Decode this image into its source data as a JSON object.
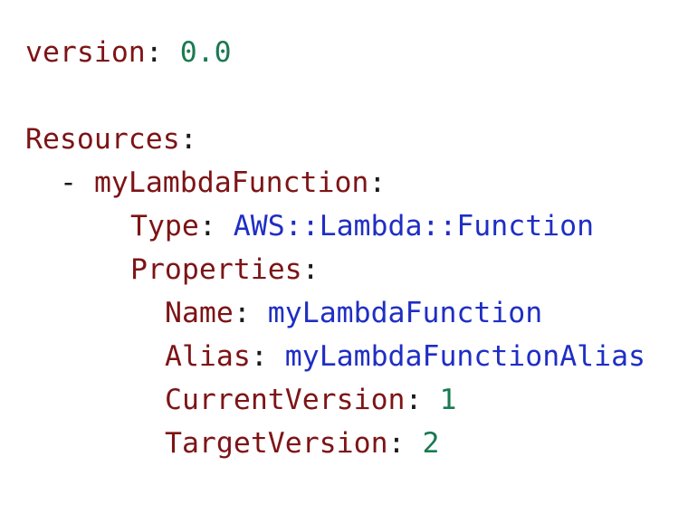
{
  "colors": {
    "key": "#7d1416",
    "punctuation": "#1a1a1a",
    "number": "#1a7a52",
    "string": "#1f2ec4",
    "background": "#ffffff"
  },
  "lines": {
    "version": {
      "key": "version",
      "colon": ":",
      "value": "0.0"
    },
    "resources": {
      "key": "Resources",
      "colon": ":"
    },
    "function": {
      "dash": "-",
      "key": "myLambdaFunction",
      "colon": ":"
    },
    "type": {
      "key": "Type",
      "colon": ":",
      "value": "AWS::Lambda::Function"
    },
    "properties": {
      "key": "Properties",
      "colon": ":"
    },
    "name": {
      "key": "Name",
      "colon": ":",
      "value": "myLambdaFunction"
    },
    "alias": {
      "key": "Alias",
      "colon": ":",
      "value": "myLambdaFunctionAlias"
    },
    "current_version": {
      "key": "CurrentVersion",
      "colon": ":",
      "value": "1"
    },
    "target_version": {
      "key": "TargetVersion",
      "colon": ":",
      "value": "2"
    }
  }
}
